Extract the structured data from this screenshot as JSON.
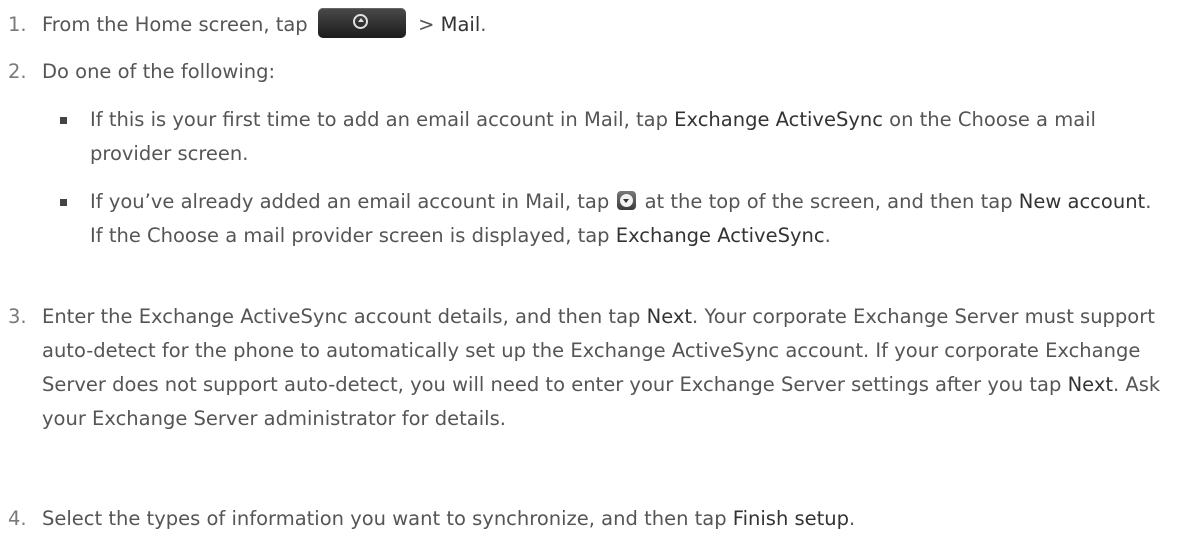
{
  "steps": [
    {
      "num": "1.",
      "a": "From the Home screen, tap",
      "b": " > ",
      "c": "Mail",
      "d": "."
    },
    {
      "num": "2.",
      "text": "Do one of the following:"
    },
    {
      "num": "3.",
      "p1": "Enter the Exchange ActiveSync account details, and then tap ",
      "e1": "Next",
      "p2": ". Your corporate Exchange Server must support auto-detect for the phone to automatically set up the Exchange ActiveSync account. If your corporate Exchange Server does not support auto-detect, you will need to enter your Exchange Server settings after you tap ",
      "e2": "Next",
      "p3": ". Ask your Exchange Server administrator for details."
    },
    {
      "num": "4.",
      "p1": "Select the types of information you want to synchronize, and then tap ",
      "e1": "Finish setup",
      "p2": "."
    }
  ],
  "bullets": [
    {
      "p1": "If this is your first time to add an email account in Mail, tap ",
      "e1": "Exchange ActiveSync",
      "p2": " on the Choose a mail provider screen."
    },
    {
      "p1": "If you’ve already added an email account in Mail, tap ",
      "p2": " at the top of the screen, and then tap ",
      "e1": "New account",
      "p3": ". If the Choose a mail provider screen is displayed, tap ",
      "e2": "Exchange ActiveSync",
      "p4": "."
    }
  ],
  "icons": {
    "home_button": "all-apps-button-icon",
    "dropdown": "dropdown-arrow-icon"
  }
}
